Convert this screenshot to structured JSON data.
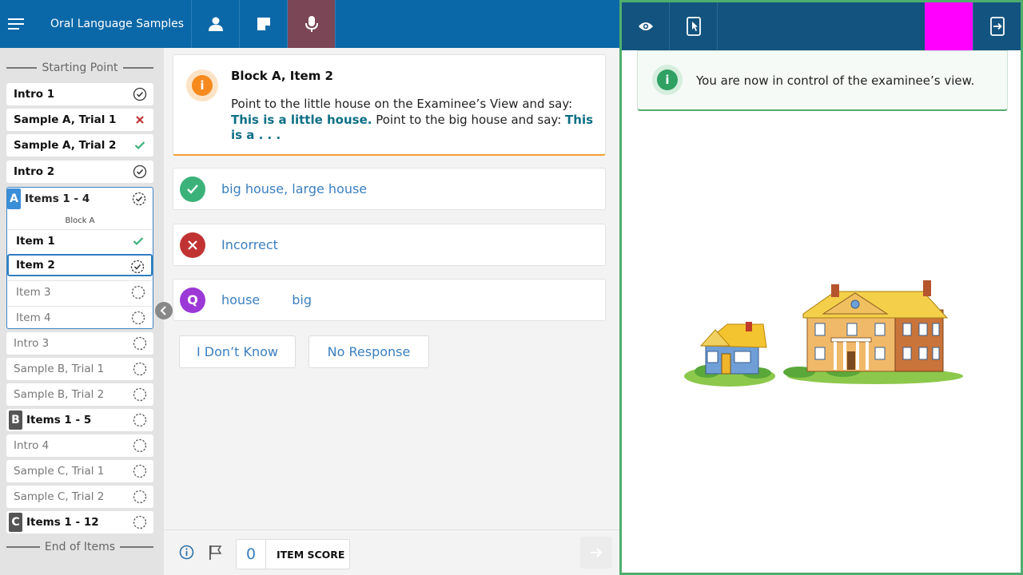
{
  "header": {
    "title": "Oral Language Samples",
    "icons": [
      "hamburger-menu-icon",
      "person-icon",
      "note-icon",
      "microphone-icon"
    ]
  },
  "sidebar": {
    "start_label": "Starting Point",
    "end_label": "End of Items",
    "items_top": [
      {
        "label": "Intro 1",
        "status": "complete"
      },
      {
        "label": "Sample A, Trial 1",
        "status": "incorrect"
      },
      {
        "label": "Sample A, Trial 2",
        "status": "correct"
      },
      {
        "label": "Intro 2",
        "status": "complete"
      }
    ],
    "block_a": {
      "badge": "A",
      "title": "Items 1 - 4",
      "subtitle": "Block A",
      "items": [
        {
          "label": "Item 1",
          "status": "correct"
        },
        {
          "label": "Item 2",
          "status": "in-progress"
        },
        {
          "label": "Item 3",
          "status": "pending"
        },
        {
          "label": "Item 4",
          "status": "pending"
        }
      ]
    },
    "items_bottom": [
      {
        "label": "Intro 3",
        "status": "pending"
      },
      {
        "label": "Sample B, Trial 1",
        "status": "pending"
      },
      {
        "label": "Sample B, Trial 2",
        "status": "pending"
      },
      {
        "badge": "B",
        "label": "Items 1 - 5",
        "status": "pending"
      },
      {
        "label": "Intro 4",
        "status": "pending"
      },
      {
        "label": "Sample C, Trial 1",
        "status": "pending"
      },
      {
        "label": "Sample C, Trial 2",
        "status": "pending"
      },
      {
        "badge": "C",
        "label": "Items 1 - 12",
        "status": "pending"
      }
    ]
  },
  "item_card": {
    "title": "Block A, Item 2",
    "instruction_1": "Point to the little house on the Examinee’s View and say: ",
    "prompt_1": "This is a little house.",
    "instruction_2": " Point to the big house and say: ",
    "prompt_2": "This is a . . ."
  },
  "responses": {
    "correct": "big house, large house",
    "incorrect": "Incorrect",
    "query_words": [
      "house",
      "big"
    ]
  },
  "buttons": {
    "dont_know": "I Don’t Know",
    "no_response": "No Response"
  },
  "footer": {
    "score_value": "0",
    "score_label": "ITEM SCORE"
  },
  "examinee_panel": {
    "notice": "You are now in control of the examinee’s view."
  },
  "colors": {
    "header_blue": "#0b68a8",
    "panel_navy": "#12547f",
    "active_mic": "#7b4656",
    "correct_green": "#3bb27a",
    "incorrect_red": "#c13333",
    "query_purple": "#9b38d6",
    "info_orange": "#f68a1f",
    "highlight_magenta": "#ff00ff"
  }
}
